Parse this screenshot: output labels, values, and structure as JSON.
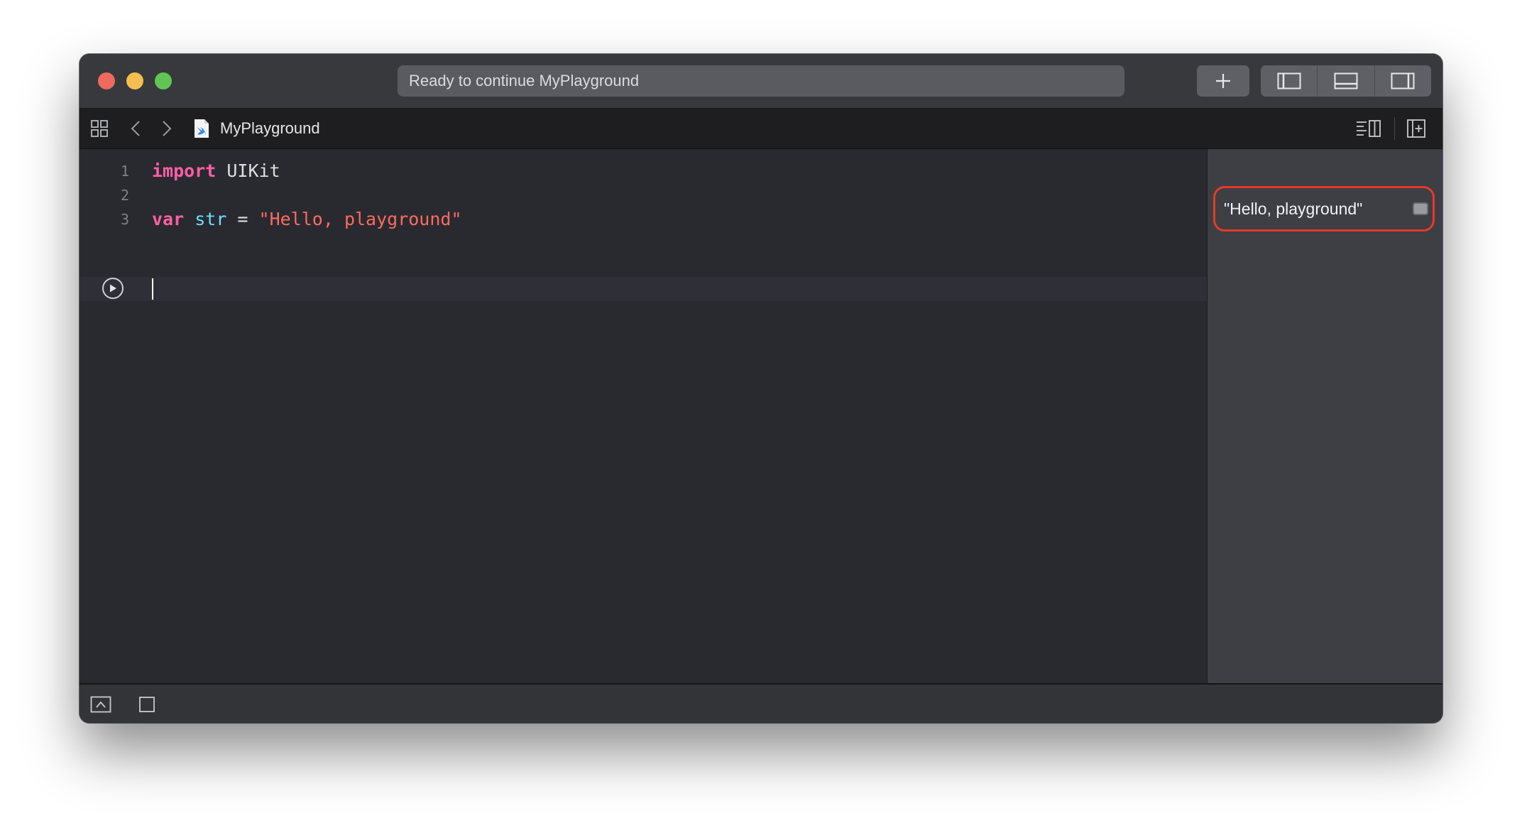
{
  "window": {
    "status_text": "Ready to continue MyPlayground",
    "traffic_lights": {
      "close": "#ed6a5e",
      "minimize": "#f5bf4f",
      "zoom": "#61c554"
    },
    "toolbar_icons": [
      "plus-icon",
      "navigator-panel-icon",
      "debug-area-icon",
      "inspector-panel-icon"
    ]
  },
  "jumpbar": {
    "icons": [
      "related-items-icon",
      "back-chevron-icon",
      "forward-chevron-icon",
      "swift-file-icon"
    ],
    "file_name": "MyPlayground",
    "right_icons": [
      "editor-options-icon",
      "add-editor-icon"
    ]
  },
  "editor": {
    "lines": [
      {
        "number": "1",
        "tokens": [
          {
            "text": "import",
            "kind": "keyword"
          },
          {
            "text": " UIKit",
            "kind": "plain"
          }
        ]
      },
      {
        "number": "2",
        "tokens": []
      },
      {
        "number": "3",
        "tokens": [
          {
            "text": "var",
            "kind": "keyword"
          },
          {
            "text": " ",
            "kind": "plain"
          },
          {
            "text": "str",
            "kind": "variable"
          },
          {
            "text": " = ",
            "kind": "plain"
          },
          {
            "text": "\"Hello, playground\"",
            "kind": "string"
          }
        ]
      }
    ],
    "colors": {
      "keyword": "#fc5fa3",
      "variable": "#6bdfff",
      "string": "#fc6a5d",
      "plain": "#dfdfe0"
    }
  },
  "results": {
    "value": "\"Hello, playground\"",
    "highlight_color": "#e8392a"
  },
  "bottombar": {
    "icons": [
      "hide-debug-area-icon",
      "stop-icon"
    ]
  }
}
